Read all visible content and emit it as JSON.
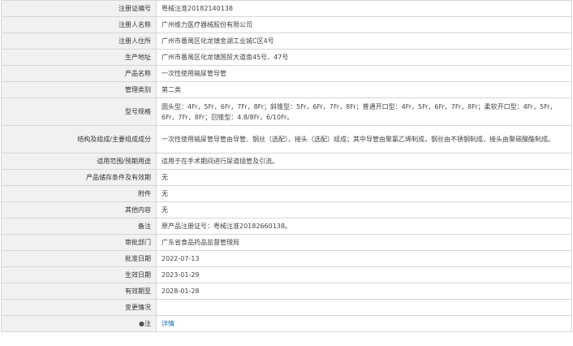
{
  "rows": [
    {
      "label": "注册证编号",
      "value": "粤械注准20182140138"
    },
    {
      "label": "注册人名称",
      "value": "广州维力医疗器械股份有限公司"
    },
    {
      "label": "注册人住所",
      "value": "广州市番禺区化龙镇金湖工业城C区4号"
    },
    {
      "label": "生产地址",
      "value": "广州市番禺区化龙镇国贸大道南45号、47号"
    },
    {
      "label": "产品名称",
      "value": "一次性使用输尿管导管"
    },
    {
      "label": "管理类别",
      "value": "第二类"
    },
    {
      "label": "型号规格",
      "value": "圆头型：4Fr，5Fr，6Fr，7Fr，8Fr；斜锥型：5Fr，6Fr，7Fr，8Fr；普通开口型：4Fr，5Fr，6Fr，7Fr，8Fr；柔软开口型：4Fr，5Fr，6Fr，7Fr，8Fr；回锥型：4.8/8Fr，6/10Fr。"
    },
    {
      "label": "结构及组成/主要组成成分",
      "value": "一次性使用输尿管导管由导管、钢丝（选配）、接头（选配）组成；其中导管由聚氯乙烯制成，钢丝由不锈钢制成，接头由聚碳酸酯制成。"
    },
    {
      "label": "适用范围/预期用途",
      "value": "适用于在手术期间进行尿道插管及引流。"
    },
    {
      "label": "产品储存条件及有效期",
      "value": "无"
    },
    {
      "label": "附件",
      "value": "无"
    },
    {
      "label": "其他内容",
      "value": "无"
    },
    {
      "label": "备注",
      "value": "原产品注册证号：粤械注准20182660138。"
    },
    {
      "label": "审批部门",
      "value": "广东省食品药品监督管理局"
    },
    {
      "label": "批准日期",
      "value": "2022-07-13"
    },
    {
      "label": "生效日期",
      "value": "2023-01-29"
    },
    {
      "label": "有效期至",
      "value": "2028-01-28"
    },
    {
      "label": "变更情况",
      "value": ""
    }
  ],
  "note_row": {
    "label": "注",
    "icon": "pin-icon",
    "link_text": "详情"
  }
}
